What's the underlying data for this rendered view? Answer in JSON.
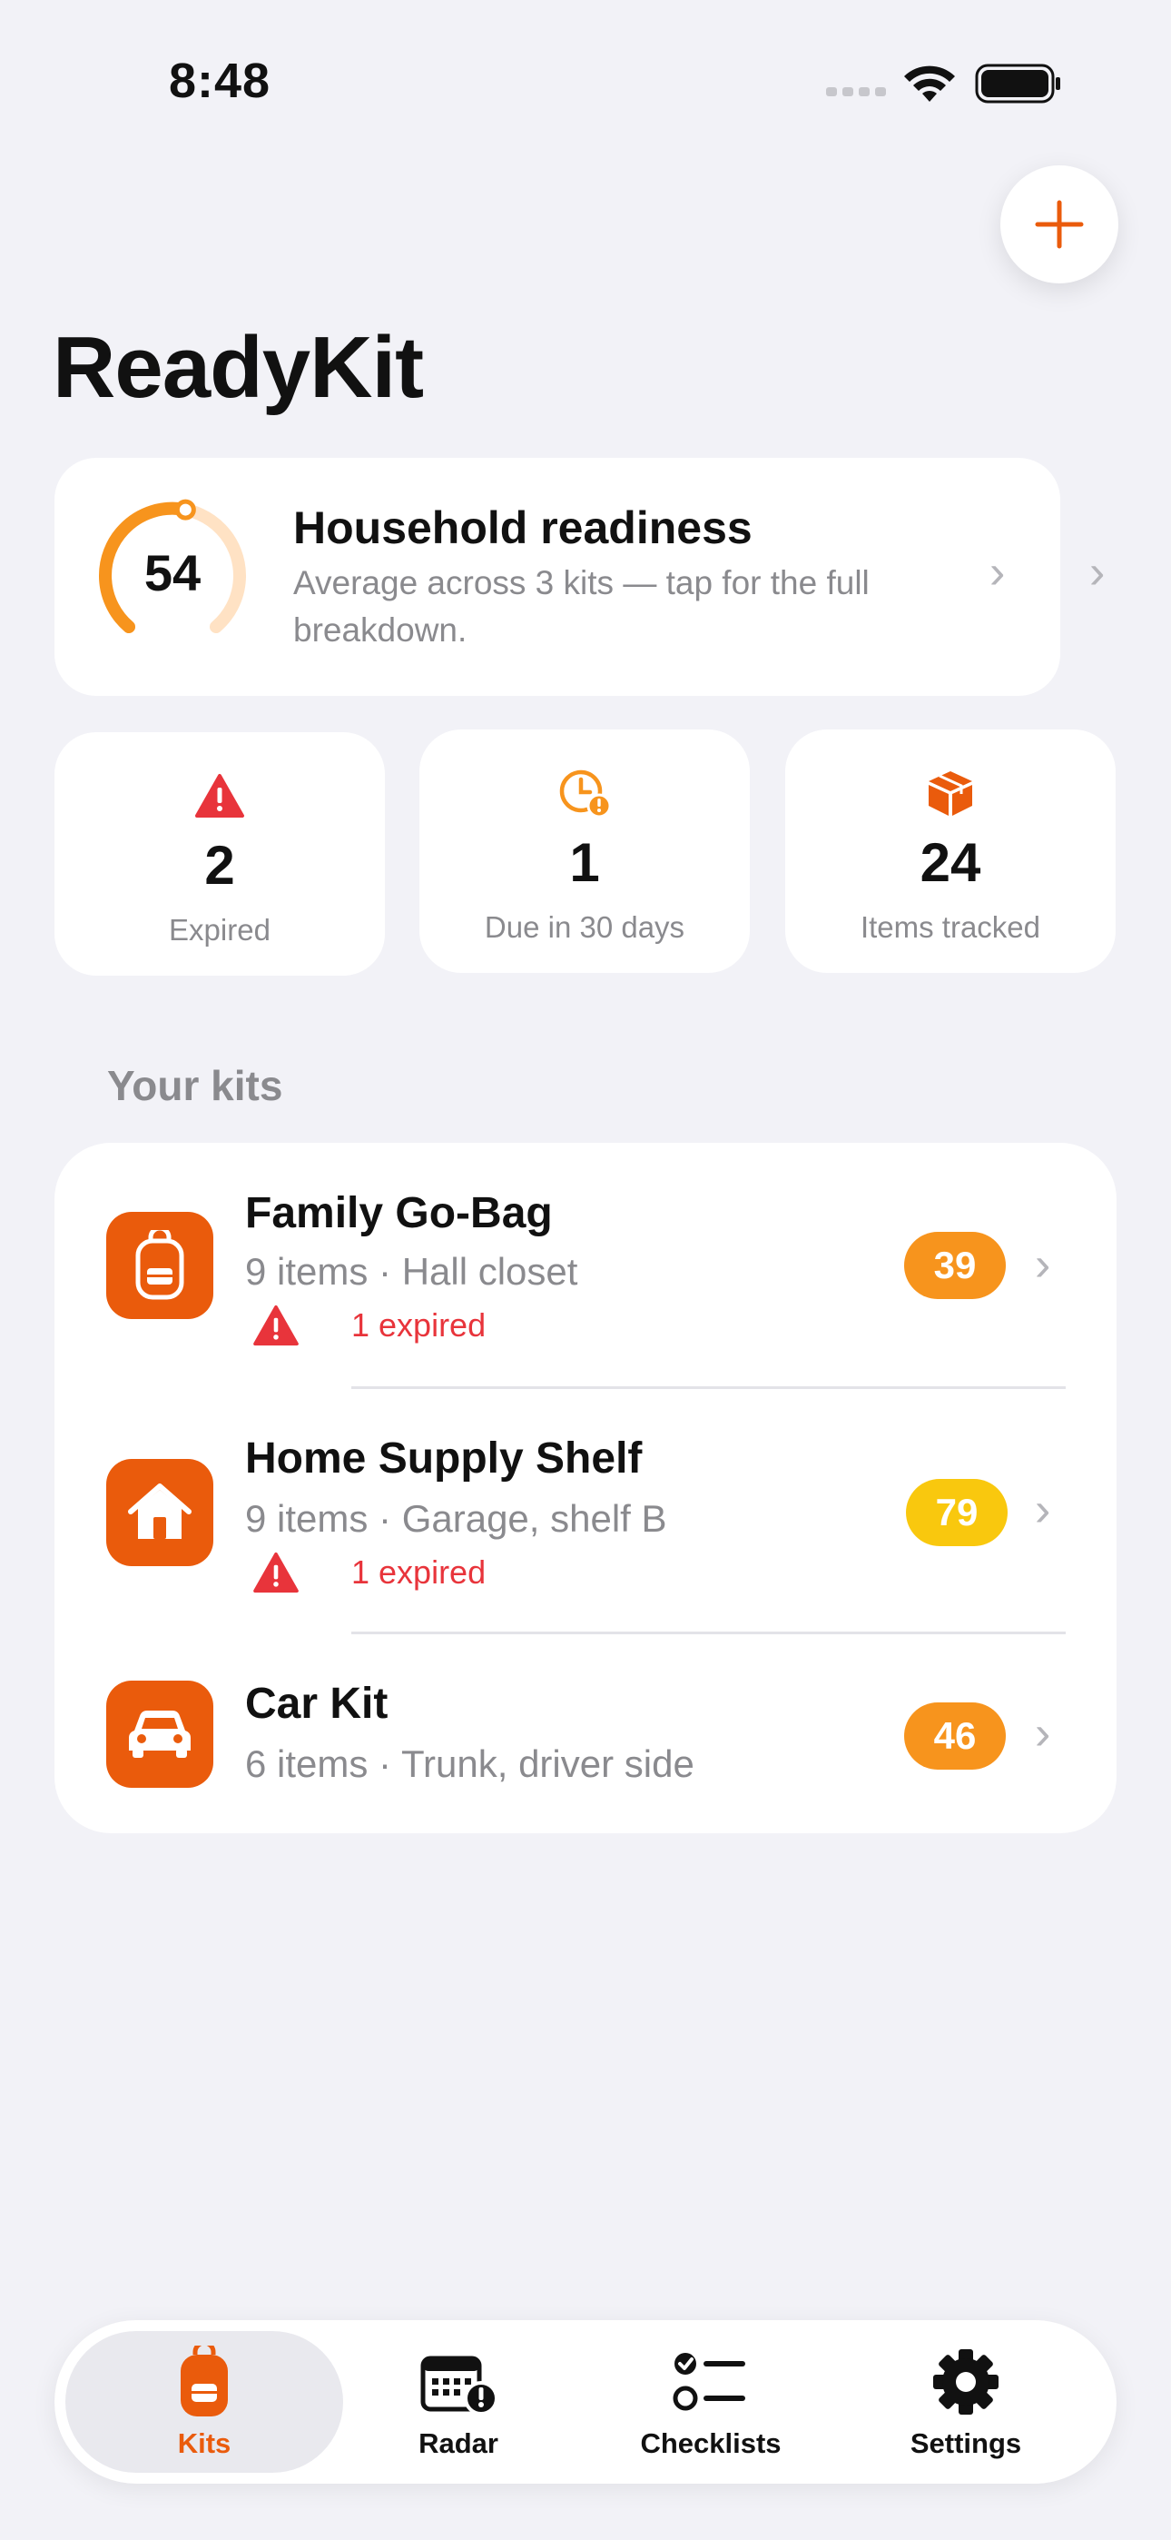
{
  "status_bar": {
    "time": "8:48",
    "icons": [
      "signal-dots-icon",
      "wifi-icon",
      "battery-icon"
    ]
  },
  "header": {
    "add_button_icon": "plus-icon",
    "title": "ReadyKit"
  },
  "readiness": {
    "score": "54",
    "score_fraction": 0.54,
    "title": "Household readiness",
    "subtitle": "Average across 3 kits — tap for the full breakdown."
  },
  "stats": [
    {
      "icon": "warning-triangle-icon",
      "value": "2",
      "label": "Expired",
      "color": "#e8343b"
    },
    {
      "icon": "clock-alert-icon",
      "value": "1",
      "label": "Due in 30 days",
      "color": "#f7941d"
    },
    {
      "icon": "box-icon",
      "value": "24",
      "label": "Items tracked",
      "color": "#ea5b0c"
    }
  ],
  "kits_section": {
    "title": "Your kits",
    "kits": [
      {
        "icon": "backpack-icon",
        "name": "Family Go-Bag",
        "meta": "9 items · Hall closet",
        "warning": "1 expired",
        "score": "39",
        "badge_color": "#f7941d"
      },
      {
        "icon": "house-icon",
        "name": "Home Supply Shelf",
        "meta": "9 items · Garage, shelf B",
        "warning": "1 expired",
        "score": "79",
        "badge_color": "#f9c80e"
      },
      {
        "icon": "car-icon",
        "name": "Car Kit",
        "meta": "6 items · Trunk, driver side",
        "warning": "",
        "score": "46",
        "badge_color": "#f7941d"
      }
    ]
  },
  "tabbar": {
    "tabs": [
      {
        "icon": "backpack-icon",
        "label": "Kits",
        "active": true
      },
      {
        "icon": "calendar-alert-icon",
        "label": "Radar",
        "active": false
      },
      {
        "icon": "checklist-icon",
        "label": "Checklists",
        "active": false
      },
      {
        "icon": "gear-icon",
        "label": "Settings",
        "active": false
      }
    ]
  },
  "colors": {
    "accent": "#ea5b0c",
    "orange": "#f7941d",
    "warning_red": "#e8343b",
    "background": "#f2f2f7"
  }
}
